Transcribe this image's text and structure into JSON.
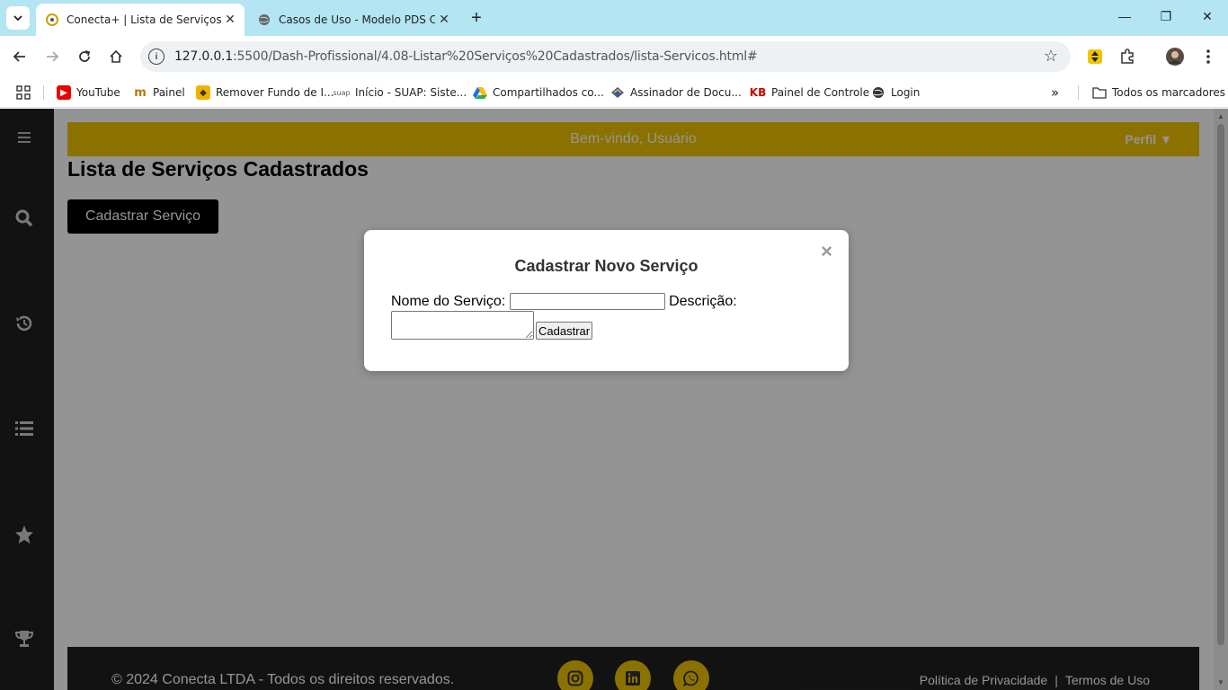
{
  "browser": {
    "tabs": [
      {
        "title": "Conecta+ | Lista de Serviços",
        "active": true
      },
      {
        "title": "Casos de Uso - Modelo PDS Co",
        "active": false
      }
    ],
    "url_host": "127.0.0.1",
    "url_rest": ":5500/Dash-Profissional/4.08-Listar%20Serviços%20Cadastrados/lista-Servicos.html#",
    "bookmarks": [
      {
        "label": "YouTube",
        "icon": "youtube-icon"
      },
      {
        "label": "Painel",
        "icon": "painel-icon"
      },
      {
        "label": "Remover Fundo de I...",
        "icon": "remove-bg-icon"
      },
      {
        "label": "Início - SUAP: Siste...",
        "icon": "suap-icon"
      },
      {
        "label": "Compartilhados co...",
        "icon": "google-drive-icon"
      },
      {
        "label": "Assinador de Docu...",
        "icon": "assinador-icon"
      },
      {
        "label": "Painel de Controle",
        "icon": "kb-icon"
      },
      {
        "label": "Login",
        "icon": "globe-icon"
      }
    ],
    "all_bookmarks_label": "Todos os marcadores",
    "suap_prefix": "suap",
    "kb_prefix": "KB"
  },
  "page": {
    "header": {
      "welcome": "Bem-vindo, Usuário",
      "profile": "Perfil ▼"
    },
    "title": "Lista de Serviços Cadastrados",
    "add_button": "Cadastrar Serviço",
    "footer": {
      "copyright": "© 2024 Conecta LTDA - Todos os direitos reservados.",
      "privacy": "Política de Privacidade",
      "separator": "|",
      "terms": "Termos de Uso"
    },
    "colors": {
      "accent": "#f0c400",
      "sidebar": "#202020",
      "overlay": "rgba(0,0,0,0.42)"
    }
  },
  "modal": {
    "title": "Cadastrar Novo Serviço",
    "close": "×",
    "name_label": "Nome do Serviço:",
    "name_value": "",
    "description_label": "Descrição:",
    "description_value": "",
    "submit_label": "Cadastrar"
  }
}
